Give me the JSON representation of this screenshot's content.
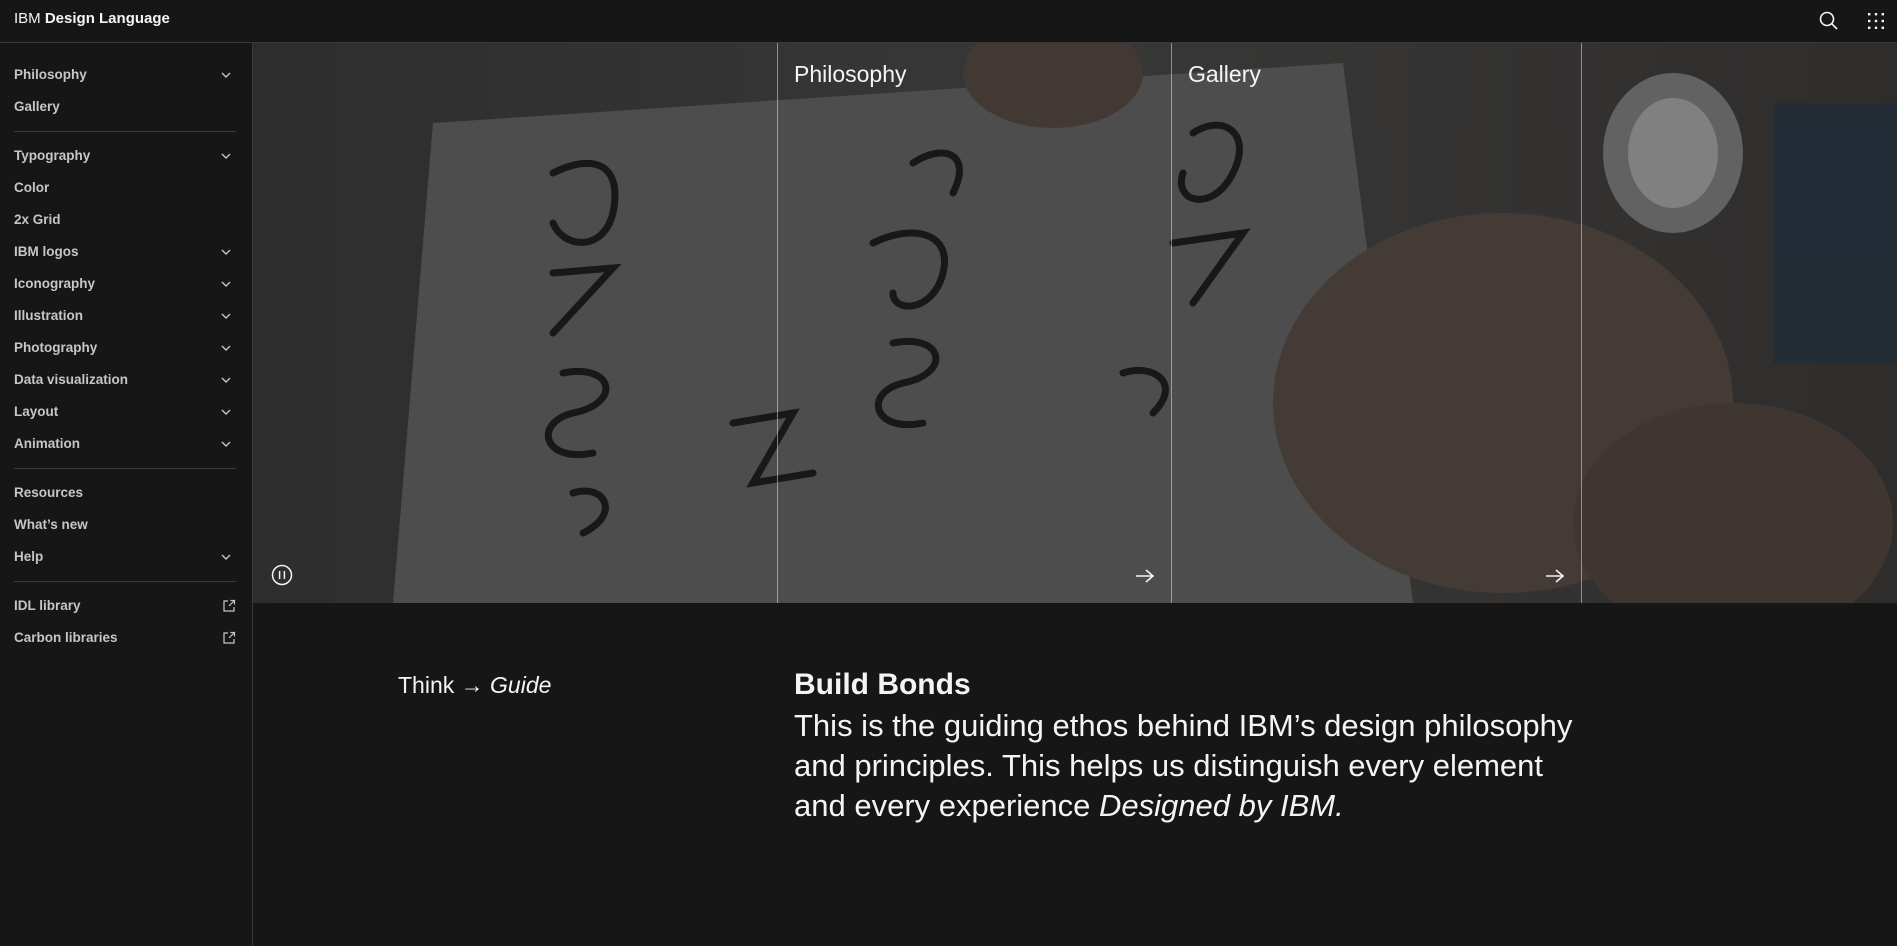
{
  "header": {
    "brand_prefix": "IBM",
    "brand_name": "Design Language",
    "search_icon": "search-icon",
    "switcher_icon": "app-switcher-icon"
  },
  "sidebar": {
    "groups": [
      [
        {
          "label": "Philosophy",
          "chevron": true
        },
        {
          "label": "Gallery",
          "chevron": false
        }
      ],
      [
        {
          "label": "Typography",
          "chevron": true
        },
        {
          "label": "Color",
          "chevron": false
        },
        {
          "label": "2x Grid",
          "chevron": false
        },
        {
          "label": "IBM logos",
          "chevron": true
        },
        {
          "label": "Iconography",
          "chevron": true
        },
        {
          "label": "Illustration",
          "chevron": true
        },
        {
          "label": "Photography",
          "chevron": true
        },
        {
          "label": "Data visualization",
          "chevron": true
        },
        {
          "label": "Layout",
          "chevron": true
        },
        {
          "label": "Animation",
          "chevron": true
        }
      ],
      [
        {
          "label": "Resources",
          "chevron": false
        },
        {
          "label": "What’s new",
          "chevron": false
        },
        {
          "label": "Help",
          "chevron": true
        }
      ],
      [
        {
          "label": "IDL library",
          "external": true
        },
        {
          "label": "Carbon libraries",
          "external": true
        }
      ]
    ]
  },
  "hero": {
    "cards": [
      {
        "title": "Philosophy",
        "arrow_icon": "arrow-right-icon"
      },
      {
        "title": "Gallery",
        "arrow_icon": "arrow-right-icon"
      }
    ],
    "pause_icon": "pause-icon"
  },
  "main": {
    "lead_plain": "Think → ",
    "lead_italic": "Guide",
    "heading": "Build Bonds",
    "body_text": "This is the guiding ethos behind IBM’s design philosophy and principles. This helps us distinguish every element and every experience ",
    "body_italic": "Designed by IBM."
  },
  "colors": {
    "background": "#161616",
    "text": "#f4f4f4",
    "nav_text": "#c6c6c6",
    "divider": "#393939"
  }
}
